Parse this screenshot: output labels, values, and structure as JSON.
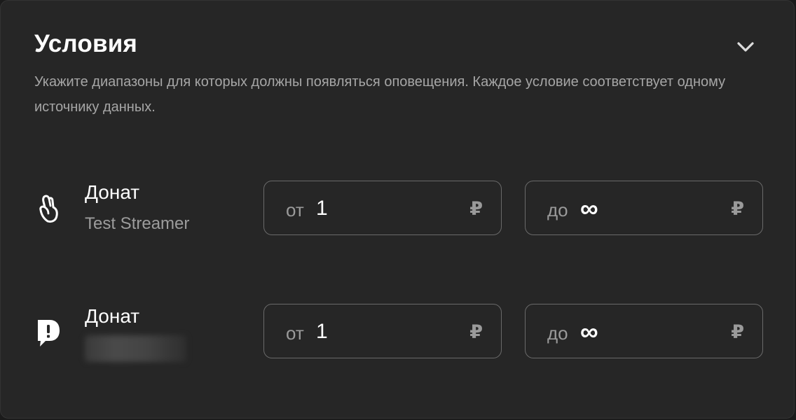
{
  "section": {
    "title": "Условия",
    "description": "Укажите диапазоны для которых должны появляться оповещения. Каждое условие соответствует одному источнику данных."
  },
  "conditions": [
    {
      "icon": "hand-gesture-icon",
      "name": "Донат",
      "subtitle": "Test Streamer",
      "from": {
        "prefix": "от",
        "value": "1",
        "currency": "₽"
      },
      "to": {
        "prefix": "до",
        "value": "∞",
        "currency": "₽"
      }
    },
    {
      "icon": "donationalerts-icon",
      "name": "Донат",
      "subtitle": "",
      "from": {
        "prefix": "от",
        "value": "1",
        "currency": "₽"
      },
      "to": {
        "prefix": "до",
        "value": "∞",
        "currency": "₽"
      }
    }
  ],
  "colors": {
    "card_bg": "#262626",
    "field_border": "#6a6a6a",
    "text_primary": "#ffffff",
    "text_secondary": "#a6a6a6"
  }
}
